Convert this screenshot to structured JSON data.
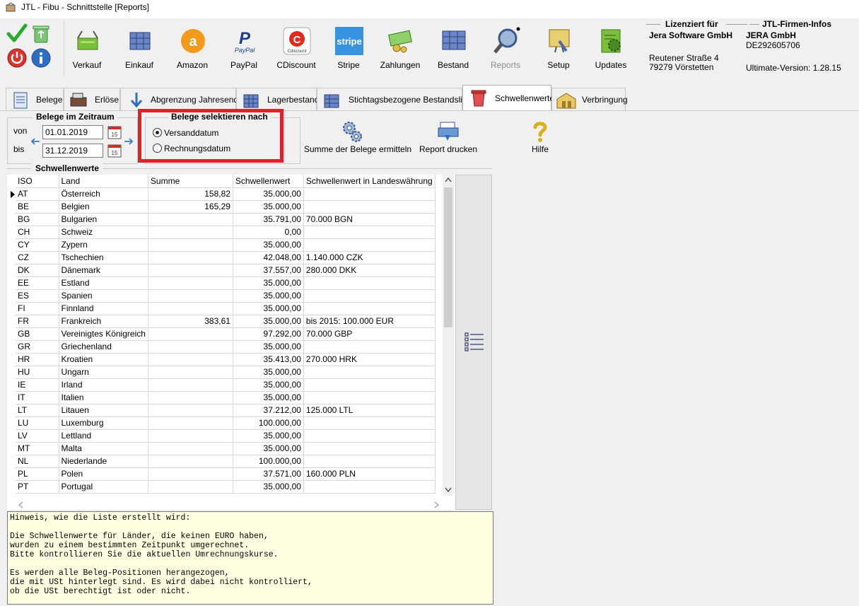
{
  "window": {
    "title": "JTL - Fibu - Schnittstelle [Reports]"
  },
  "toolbar": {
    "items": [
      {
        "label": "Verkauf",
        "icon": "basket-icon"
      },
      {
        "label": "Einkauf",
        "icon": "boxes-icon"
      },
      {
        "label": "Amazon",
        "icon": "amazon-icon"
      },
      {
        "label": "PayPal",
        "icon": "paypal-icon"
      },
      {
        "label": "CDiscount",
        "icon": "cdiscount-icon"
      },
      {
        "label": "Stripe",
        "icon": "stripe-icon"
      },
      {
        "label": "Zahlungen",
        "icon": "money-icon"
      },
      {
        "label": "Bestand",
        "icon": "pallet-icon"
      },
      {
        "label": "Reports",
        "icon": "magnifier-icon",
        "disabled": true
      },
      {
        "label": "Setup",
        "icon": "setup-icon"
      },
      {
        "label": "Updates",
        "icon": "updates-icon"
      }
    ],
    "paypal_logo_text": "PayPal",
    "cdiscount_logo_text": "Cdiscount",
    "stripe_logo_text": "stripe"
  },
  "license": {
    "heading": "Lizenziert für",
    "company": "Jera Software GmbH",
    "street": "Reutener Straße 4",
    "city": "79279 Vörstetten",
    "firm_heading": "JTL-Firmen-Infos",
    "firm_name": "JERA GmbH",
    "vat_id": "DE292605706",
    "version": "Ultimate-Version: 1.28.15"
  },
  "tabs": [
    {
      "label": "Belege"
    },
    {
      "label": "Erlöse"
    },
    {
      "label": "Abgrenzung Jahresende"
    },
    {
      "label": "Lagerbestand"
    },
    {
      "label": "Stichtagsbezogene Bestandsliste"
    },
    {
      "label": "Schwellenwerte",
      "active": true
    },
    {
      "label": "Verbringung"
    }
  ],
  "period": {
    "title": "Belege im Zeitraum",
    "from_label": "von",
    "from_value": "01.01.2019",
    "to_label": "bis",
    "to_value": "31.12.2019",
    "cal_text": "15"
  },
  "select_by": {
    "title": "Belege selektieren nach",
    "options": [
      "Versanddatum",
      "Rechnungsdatum"
    ],
    "selected": "Versanddatum"
  },
  "actions": {
    "sum": "Summe der Belege ermitteln",
    "print": "Report drucken",
    "help": "Hilfe"
  },
  "grid": {
    "title": "Schwellenwerte",
    "columns": [
      "ISO",
      "Land",
      "Summe",
      "Schwellenwert",
      "Schwellenwert in Landeswährung"
    ],
    "rows": [
      [
        "AT",
        "Österreich",
        "158,82",
        "35.000,00",
        ""
      ],
      [
        "BE",
        "Belgien",
        "165,29",
        "35.000,00",
        ""
      ],
      [
        "BG",
        "Bulgarien",
        "",
        "35.791,00",
        "70.000 BGN"
      ],
      [
        "CH",
        "Schweiz",
        "",
        "0,00",
        ""
      ],
      [
        "CY",
        "Zypern",
        "",
        "35.000,00",
        ""
      ],
      [
        "CZ",
        "Tschechien",
        "",
        "42.048,00",
        "1.140.000 CZK"
      ],
      [
        "DK",
        "Dänemark",
        "",
        "37.557,00",
        "280.000 DKK"
      ],
      [
        "EE",
        "Estland",
        "",
        "35.000,00",
        ""
      ],
      [
        "ES",
        "Spanien",
        "",
        "35.000,00",
        ""
      ],
      [
        "FI",
        "Finnland",
        "",
        "35.000,00",
        ""
      ],
      [
        "FR",
        "Frankreich",
        "383,61",
        "35.000,00",
        "bis 2015: 100.000 EUR"
      ],
      [
        "GB",
        "Vereinigtes Königreich",
        "",
        "97.292,00",
        "70.000 GBP"
      ],
      [
        "GR",
        "Griechenland",
        "",
        "35.000,00",
        ""
      ],
      [
        "HR",
        "Kroatien",
        "",
        "35.413,00",
        "270.000 HRK"
      ],
      [
        "HU",
        "Ungarn",
        "",
        "35.000,00",
        ""
      ],
      [
        "IE",
        "Irland",
        "",
        "35.000,00",
        ""
      ],
      [
        "IT",
        "Italien",
        "",
        "35.000,00",
        ""
      ],
      [
        "LT",
        "Litauen",
        "",
        "37.212,00",
        "125.000 LTL"
      ],
      [
        "LU",
        "Luxemburg",
        "",
        "100.000,00",
        ""
      ],
      [
        "LV",
        "Lettland",
        "",
        "35.000,00",
        ""
      ],
      [
        "MT",
        "Malta",
        "",
        "35.000,00",
        ""
      ],
      [
        "NL",
        "Niederlande",
        "",
        "100.000,00",
        ""
      ],
      [
        "PL",
        "Polen",
        "",
        "37.571,00",
        "160.000 PLN"
      ],
      [
        "PT",
        "Portugal",
        "",
        "35.000,00",
        ""
      ]
    ]
  },
  "hint": {
    "lines": [
      "Hinweis, wie die Liste erstellt wird:",
      "",
      "Die Schwellenwerte für Länder, die keinen EURO haben,",
      "wurden zu einem bestimmten Zeitpunkt umgerechnet.",
      "Bitte kontrollieren Sie die aktuellen Umrechnungskurse.",
      "",
      "Es werden alle Beleg-Positionen herangezogen,",
      "die mit USt hinterlegt sind. Es wird dabei nicht kontrolliert,",
      "ob die USt berechtigt ist oder nicht."
    ]
  }
}
